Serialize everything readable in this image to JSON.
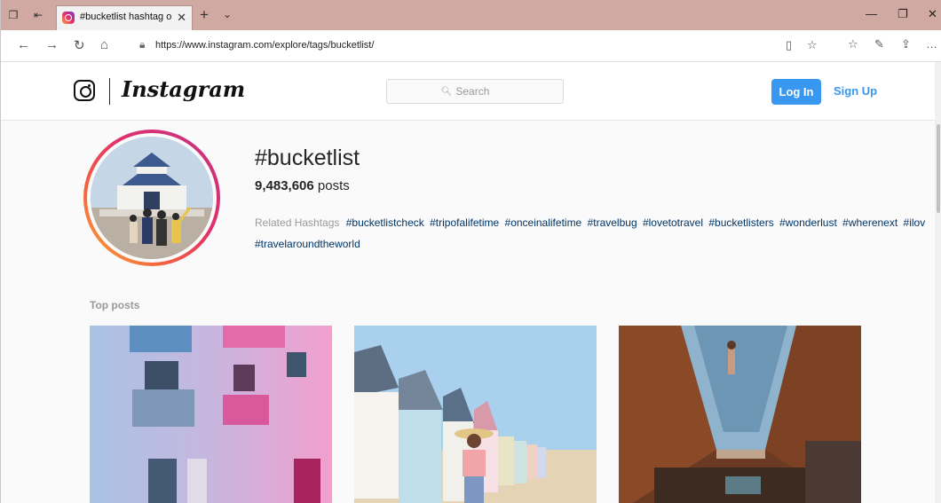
{
  "browser": {
    "tab_title": "#bucketlist hashtag on I",
    "url": "https://www.instagram.com/explore/tags/bucketlist/"
  },
  "header": {
    "logo_text": "Instagram",
    "search_placeholder": "Search",
    "login_label": "Log In",
    "signup_label": "Sign Up"
  },
  "hashtag": {
    "title": "#bucketlist",
    "post_count": "9,483,606",
    "post_count_suffix": "posts",
    "related_label": "Related Hashtags",
    "related": [
      "#bucketlistcheck",
      "#tripofalifetime",
      "#onceinalifetime",
      "#travelbug",
      "#lovetotravel",
      "#bucketlisters",
      "#wonderlust",
      "#wherenext",
      "#ilov",
      "#travelaroundtheworld"
    ]
  },
  "section": {
    "top_posts_label": "Top posts"
  },
  "colors": {
    "accent": "#3897f0",
    "titlebar": "#d1a9a3"
  }
}
